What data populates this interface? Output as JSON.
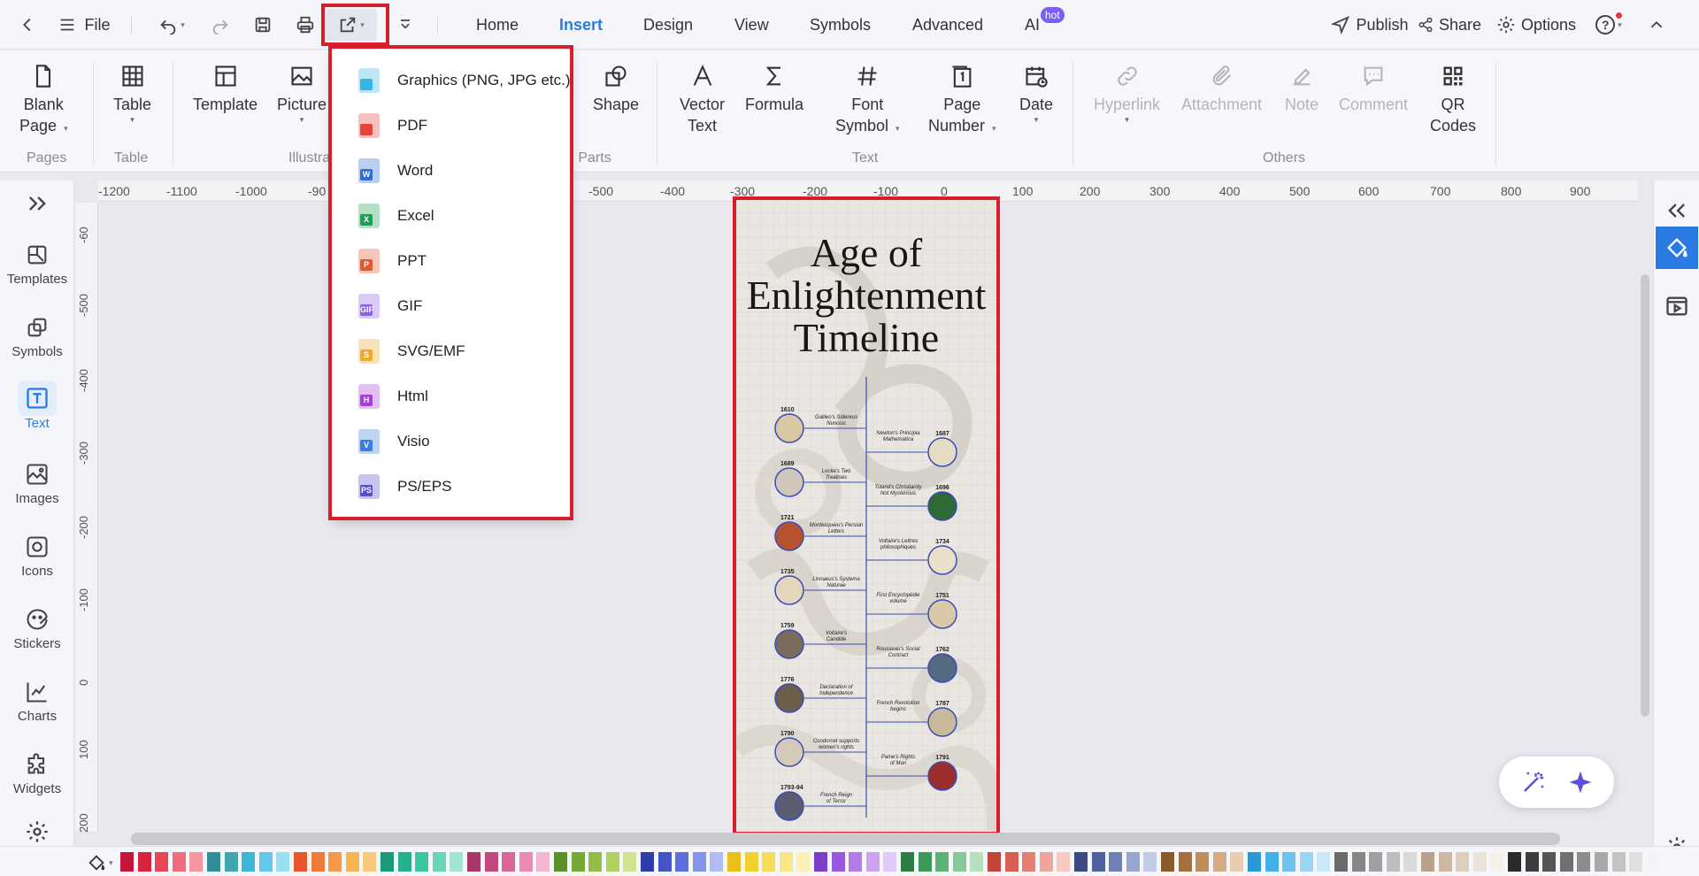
{
  "topbar": {
    "file_label": "File",
    "tabs": [
      "Home",
      "Insert",
      "Design",
      "View",
      "Symbols",
      "Advanced",
      "AI"
    ],
    "active_tab": "Insert",
    "hot_badge": "hot",
    "publish_label": "Publish",
    "share_label": "Share",
    "options_label": "Options",
    "help_label": "?"
  },
  "ribbon": {
    "blank_page": [
      "Blank",
      "Page"
    ],
    "table": "Table",
    "template": "Template",
    "picture": "Picture",
    "shape": "Shape",
    "vector_text": [
      "Vector",
      "Text"
    ],
    "formula": "Formula",
    "font_symbol": [
      "Font",
      "Symbol"
    ],
    "page_number": [
      "Page",
      "Number"
    ],
    "date": "Date",
    "hyperlink": "Hyperlink",
    "attachment": "Attachment",
    "note": "Note",
    "comment": "Comment",
    "qr_codes": [
      "QR",
      "Codes"
    ],
    "groups": {
      "pages": "Pages",
      "table": "Table",
      "illustrations": "Illustra",
      "parts": "n Parts",
      "text": "Text",
      "others": "Others"
    }
  },
  "export_menu": {
    "items": [
      {
        "label": "Graphics (PNG, JPG etc.)",
        "icon": "image-file-icon",
        "color": "#35b6e8"
      },
      {
        "label": "PDF",
        "icon": "pdf-file-icon",
        "color": "#e2443b"
      },
      {
        "label": "Word",
        "icon": "word-file-icon",
        "color": "#2d6fd6",
        "badge": "W"
      },
      {
        "label": "Excel",
        "icon": "excel-file-icon",
        "color": "#1f9d55",
        "badge": "X"
      },
      {
        "label": "PPT",
        "icon": "ppt-file-icon",
        "color": "#e5572c",
        "badge": "P"
      },
      {
        "label": "GIF",
        "icon": "gif-file-icon",
        "color": "#8b63e6",
        "badge": "GIF"
      },
      {
        "label": "SVG/EMF",
        "icon": "svg-file-icon",
        "color": "#f0a92b",
        "badge": "S"
      },
      {
        "label": "Html",
        "icon": "html-file-icon",
        "color": "#a33fd6",
        "badge": "H"
      },
      {
        "label": "Visio",
        "icon": "visio-file-icon",
        "color": "#3b7de0",
        "badge": "V"
      },
      {
        "label": "PS/EPS",
        "icon": "ps-file-icon",
        "color": "#5a4fc9",
        "badge": "PS"
      }
    ]
  },
  "ruler": {
    "h": [
      "-1200",
      "-1100",
      "-1000",
      "-90",
      "-500",
      "-400",
      "-300",
      "-200",
      "-100",
      "0",
      "100",
      "200",
      "300",
      "400",
      "500",
      "600",
      "700",
      "800",
      "900"
    ],
    "v": [
      "-60",
      "-500",
      "-400",
      "-300",
      "-200",
      "-100",
      "0",
      "100",
      "200"
    ]
  },
  "left_panel": [
    "Templates",
    "Symbols",
    "Text",
    "Images",
    "Icons",
    "Stickers",
    "Charts",
    "Widgets"
  ],
  "left_active": "Text",
  "poster": {
    "title": [
      "Age of",
      "Enlightenment",
      "Timeline"
    ],
    "left_events": [
      {
        "year": "1610",
        "label": "Galileo's Sidereus Nuncius",
        "color": "#d9c8a2"
      },
      {
        "year": "1689",
        "label": "Locke's Two Treatises",
        "color": "#cfc7bb"
      },
      {
        "year": "1721",
        "label": "Montesquieu's Persian Letters",
        "color": "#b5532f"
      },
      {
        "year": "1735",
        "label": "Linnaeus's Systema Naturae",
        "color": "#e2d6bc"
      },
      {
        "year": "1759",
        "label": "Voltaire's Candide",
        "color": "#7a6b5c"
      },
      {
        "year": "1776",
        "label": "Declaration of Independence",
        "color": "#6b5e4a"
      },
      {
        "year": "1790",
        "label": "Condorcet supports women's rights",
        "color": "#d4cab7"
      },
      {
        "year": "1793-94",
        "label": "French Reign of Terror",
        "color": "#5c5c70"
      }
    ],
    "right_events": [
      {
        "year": "1687",
        "label": "Newton's Principia Mathematica",
        "color": "#e5dcc4"
      },
      {
        "year": "1696",
        "label": "Toland's Christianity Not Mysterious",
        "color": "#2e6a36"
      },
      {
        "year": "1734",
        "label": "Voltaire's Lettres philosophiques",
        "color": "#e8e0c8"
      },
      {
        "year": "1751",
        "label": "First Encyclopédie volume",
        "color": "#d8c9a9"
      },
      {
        "year": "1762",
        "label": "Rousseau's Social Contract",
        "color": "#556a80"
      },
      {
        "year": "1787",
        "label": "French Revolution begins",
        "color": "#c8b99b"
      },
      {
        "year": "1791",
        "label": "Paine's Rights of Man",
        "color": "#9c2d2d"
      }
    ]
  },
  "palette_colors": [
    "#c4163a",
    "#d8233f",
    "#e84657",
    "#f06b7c",
    "#f596a1",
    "#2f8f99",
    "#3fa6b0",
    "#3bb6d8",
    "#62c8e8",
    "#9adff0",
    "#e8562d",
    "#f07a3a",
    "#f59945",
    "#f8b54f",
    "#f9c97a",
    "#1b9a7a",
    "#24b08e",
    "#3cc5a2",
    "#67d6b9",
    "#a1e5d1",
    "#a8386a",
    "#c2497f",
    "#d9669a",
    "#e98bb4",
    "#f3b5d0",
    "#5b8f2a",
    "#76a836",
    "#93bd45",
    "#b0d15d",
    "#cfe391",
    "#2f3da8",
    "#4455c8",
    "#5d6fdc",
    "#8494ea",
    "#b1bcf3",
    "#e8c019",
    "#f1d030",
    "#f5dd59",
    "#f8e786",
    "#fbf1b8",
    "#7e3fc7",
    "#9a58dc",
    "#b47be8",
    "#cca3f1",
    "#e1caf7",
    "#2e7d46",
    "#3e9a58",
    "#5bb271",
    "#85c996",
    "#b7e0c0",
    "#c2453a",
    "#d65e52",
    "#e67f73",
    "#f0a59c",
    "#f6c9c3",
    "#3b4a80",
    "#4f619d",
    "#6f80b7",
    "#97a5cf",
    "#c3cce6",
    "#8b5a2b",
    "#a57040",
    "#bf8c5c",
    "#d6ab83",
    "#e8cdb0",
    "#2a9ad6",
    "#45b0e6",
    "#6cc4ee",
    "#9ad6f4",
    "#c7e9f9",
    "#6b6b6b",
    "#858585",
    "#a0a0a0",
    "#bdbdbd",
    "#dadada",
    "#b9a28a",
    "#cdb9a3",
    "#ddcfbd",
    "#ebe3d7",
    "#f5f1ea",
    "#2a2a2a",
    "#3d3d3d",
    "#555555",
    "#707070",
    "#8c8c8c",
    "#a8a8a8",
    "#c4c4c4",
    "#e0e0e0",
    "#f4f4f4"
  ]
}
